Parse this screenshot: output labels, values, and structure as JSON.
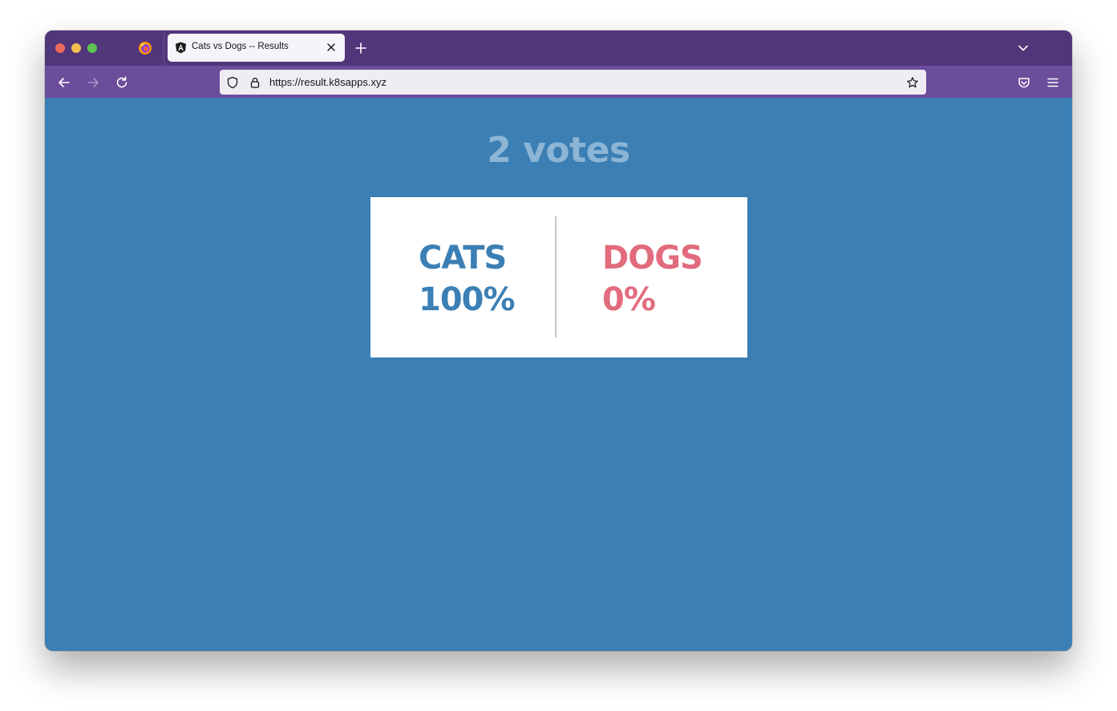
{
  "browser": {
    "tab": {
      "title": "Cats vs Dogs -- Results"
    },
    "url": "https://result.k8sapps.xyz"
  },
  "page": {
    "votes_label": "2 votes",
    "options": [
      {
        "name": "CATS",
        "percent": "100%",
        "color": "#3b7fb4"
      },
      {
        "name": "DOGS",
        "percent": "0%",
        "color": "#e26b7e"
      }
    ],
    "background_color": "#3b7fb4"
  }
}
